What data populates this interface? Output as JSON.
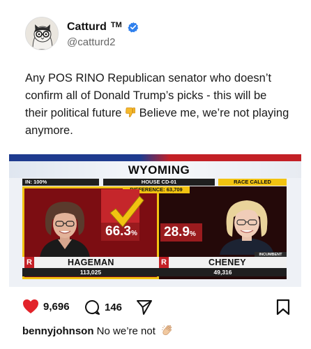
{
  "post": {
    "author_name": "Catturd",
    "author_tm": "TM",
    "handle": "@catturd2",
    "text_before_emoji": "Any POS RINO Republican senator who doesn’t confirm all of Donald Trump’s picks - this will be their political future ",
    "text_after_emoji": " Believe me, we’re not playing anymore."
  },
  "graphic": {
    "state": "WYOMING",
    "in_pct": "IN: 100%",
    "district": "HOUSE CD-01",
    "difference": "DIFFERENCE: 63,709",
    "race_called": "RACE CALLED",
    "incumbent_label": "INCUMBENT",
    "candidates": [
      {
        "party": "R",
        "name": "HAGEMAN",
        "votes": "113,025",
        "pct": "66.3",
        "pct_sign": "%",
        "winner": true
      },
      {
        "party": "R",
        "name": "CHENEY",
        "votes": "49,316",
        "pct": "28.9",
        "pct_sign": "%",
        "winner": false
      }
    ]
  },
  "actions": {
    "likes": "9,696",
    "comments": "146"
  },
  "comment": {
    "user": "bennyjohnson",
    "text": "No we’re not"
  },
  "colors": {
    "like_red": "#e2232a",
    "verified_blue": "#2f80ed",
    "fox_red": "#c32026",
    "fox_yellow": "#f2c311"
  },
  "icons": [
    "verified-icon",
    "thumbs-down-emoji-icon",
    "heart-icon",
    "comment-icon",
    "share-icon",
    "bookmark-icon",
    "clap-emoji-icon",
    "check-icon"
  ]
}
